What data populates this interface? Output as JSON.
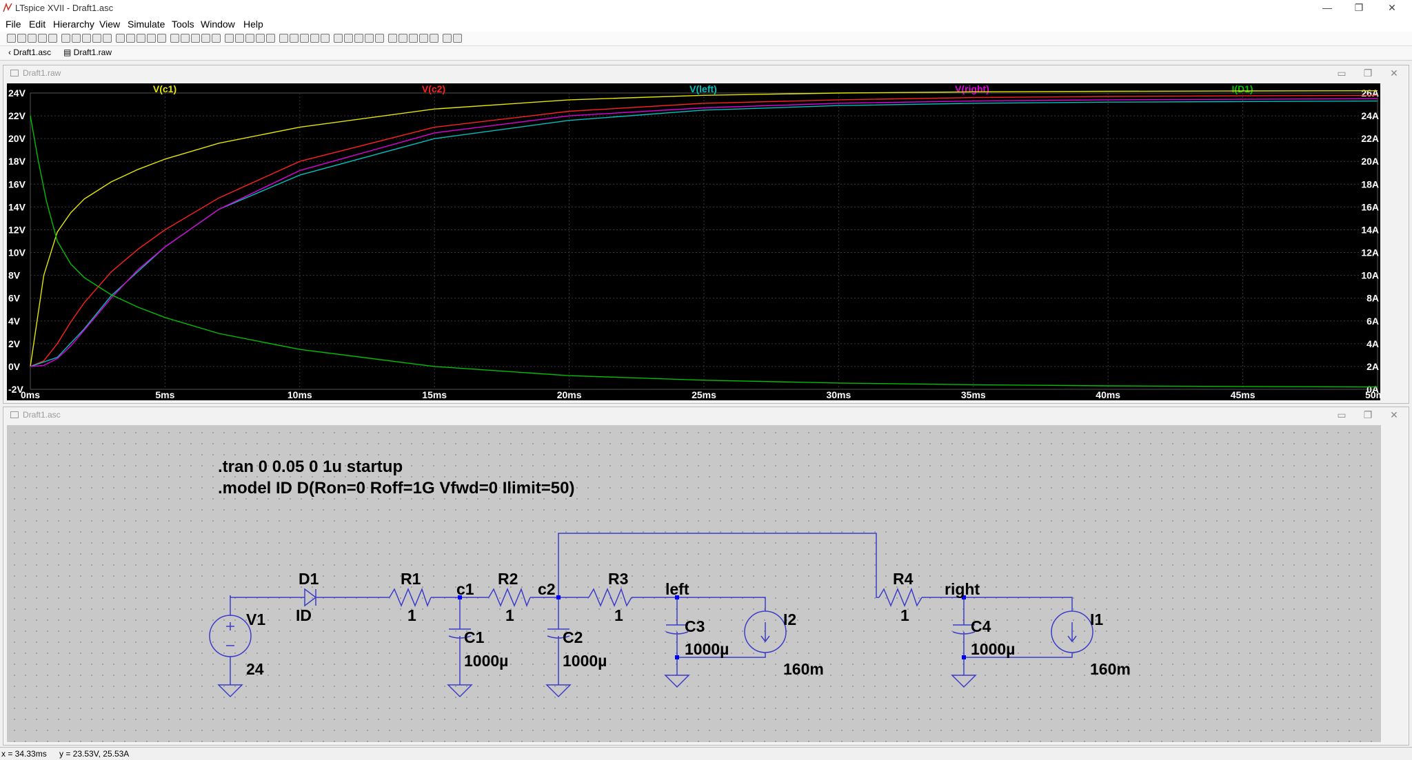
{
  "window": {
    "title": "LTspice XVII - Draft1.asc"
  },
  "menu": [
    "File",
    "Edit",
    "Hierarchy",
    "View",
    "Simulate",
    "Tools",
    "Window",
    "Help"
  ],
  "tabs": [
    {
      "label": "Draft1.asc"
    },
    {
      "label": "Draft1.raw"
    }
  ],
  "plot_window": {
    "title": "Draft1.raw"
  },
  "schematic_window": {
    "title": "Draft1.asc"
  },
  "chart_data": {
    "type": "line",
    "xlim": [
      0,
      50
    ],
    "x_ticks": [
      "0ms",
      "5ms",
      "10ms",
      "15ms",
      "20ms",
      "25ms",
      "30ms",
      "35ms",
      "40ms",
      "45ms",
      "50ms"
    ],
    "y_left_ticks": [
      "24V",
      "22V",
      "20V",
      "18V",
      "16V",
      "14V",
      "12V",
      "10V",
      "8V",
      "6V",
      "4V",
      "2V",
      "0V",
      "-2V"
    ],
    "y_right_ticks": [
      "26A",
      "24A",
      "22A",
      "20A",
      "18A",
      "16A",
      "14A",
      "12A",
      "10A",
      "8A",
      "6A",
      "4A",
      "2A",
      "0A"
    ],
    "ylim_left": [
      -2,
      24
    ],
    "ylim_right": [
      0,
      26
    ],
    "grid": true,
    "series": [
      {
        "name": "V(c1)",
        "color": "#e6e600",
        "axis": "left",
        "x": [
          0,
          0.5,
          1,
          1.5,
          2,
          3,
          4,
          5,
          7,
          10,
          15,
          20,
          25,
          30,
          35,
          40,
          45,
          50
        ],
        "y": [
          0,
          8,
          11.8,
          13.5,
          14.7,
          16.2,
          17.3,
          18.2,
          19.6,
          21,
          22.6,
          23.4,
          23.8,
          24,
          24.1,
          24.15,
          24.18,
          24.2
        ]
      },
      {
        "name": "V(c2)",
        "color": "#ff2020",
        "axis": "left",
        "x": [
          0,
          0.5,
          1,
          1.5,
          2,
          3,
          4,
          5,
          7,
          10,
          15,
          20,
          25,
          30,
          35,
          40,
          45,
          50
        ],
        "y": [
          0,
          0.5,
          2,
          3.9,
          5.6,
          8.3,
          10.3,
          12,
          14.8,
          18,
          21,
          22.4,
          23.1,
          23.4,
          23.6,
          23.7,
          23.75,
          23.8
        ]
      },
      {
        "name": "V(left)",
        "color": "#00c0c0",
        "axis": "left",
        "x": [
          0,
          1,
          2,
          3,
          5,
          7,
          10,
          15,
          20,
          25,
          30,
          35,
          40,
          45,
          50
        ],
        "y": [
          0,
          0.8,
          3.3,
          6.2,
          10.5,
          13.8,
          16.8,
          20,
          21.6,
          22.5,
          22.9,
          23.1,
          23.2,
          23.25,
          23.3
        ]
      },
      {
        "name": "V(right)",
        "color": "#e000e0",
        "axis": "left",
        "x": [
          0,
          0.5,
          1,
          1.5,
          2,
          3,
          4,
          5,
          7,
          10,
          15,
          20,
          25,
          30,
          35,
          40,
          45,
          50
        ],
        "y": [
          0,
          0.1,
          0.7,
          1.8,
          3.2,
          6,
          8.5,
          10.5,
          13.8,
          17.2,
          20.5,
          22,
          22.7,
          23.1,
          23.3,
          23.4,
          23.45,
          23.5
        ]
      },
      {
        "name": "I(D1)",
        "color": "#00c000",
        "axis": "right",
        "x": [
          0,
          0.3,
          0.6,
          1,
          1.5,
          2,
          3,
          4,
          5,
          7,
          10,
          15,
          20,
          25,
          30,
          35,
          40,
          45,
          50
        ],
        "y": [
          24,
          20,
          16.5,
          13,
          11,
          9.8,
          8.3,
          7.2,
          6.3,
          4.9,
          3.5,
          2,
          1.2,
          0.8,
          0.55,
          0.4,
          0.3,
          0.25,
          0.2
        ]
      }
    ]
  },
  "schematic": {
    "directives": [
      ".tran 0 0.05 0 1u startup",
      ".model ID D(Ron=0 Roff=1G Vfwd=0 Ilimit=50)"
    ],
    "components": [
      {
        "ref": "V1",
        "value": "24"
      },
      {
        "ref": "D1",
        "value": "ID"
      },
      {
        "ref": "R1",
        "value": "1"
      },
      {
        "ref": "R2",
        "value": "1"
      },
      {
        "ref": "R3",
        "value": "1"
      },
      {
        "ref": "R4",
        "value": "1"
      },
      {
        "ref": "C1",
        "value": "1000µ"
      },
      {
        "ref": "C2",
        "value": "1000µ"
      },
      {
        "ref": "C3",
        "value": "1000µ"
      },
      {
        "ref": "C4",
        "value": "1000µ"
      },
      {
        "ref": "I1",
        "value": "160m"
      },
      {
        "ref": "I2",
        "value": "160m"
      }
    ],
    "net_labels": [
      "c1",
      "c2",
      "left",
      "right"
    ]
  },
  "status": {
    "x": "x = 34.33ms",
    "y": "y = 23.53V, 25.53A"
  },
  "colors": {
    "wire": "#3c3cc8",
    "junction": "#0000ff",
    "component": "#3c3cc8",
    "text": "#000000",
    "schematic_bg": "#c8c8c8",
    "plot_bg": "#000000",
    "grid": "#3a3a3a",
    "axis_text": "#ffffff"
  }
}
